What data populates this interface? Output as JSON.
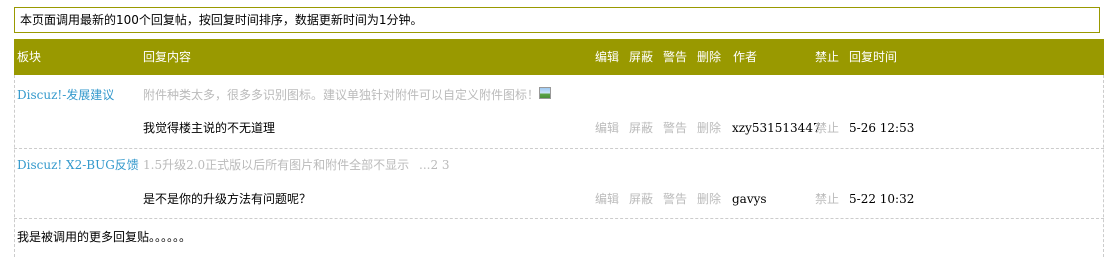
{
  "notice": "本页面调用最新的100个回复帖，按回复时间排序，数据更新时间为1分钟。",
  "columns": {
    "forum": "板块",
    "content": "回复内容",
    "edit": "编辑",
    "block": "屏蔽",
    "warn": "警告",
    "delete": "删除",
    "author": "作者",
    "ban": "禁止",
    "time": "回复时间"
  },
  "rows": [
    {
      "forum": "Discuz!-发展建议",
      "thread": "附件种类太多，很多多识别图标。建议单独针对附件可以自定义附件图标！",
      "thread_pages": "",
      "has_image_icon": true,
      "reply": "我觉得楼主说的不无道理",
      "edit": "编辑",
      "block": "屏蔽",
      "warn": "警告",
      "delete": "删除",
      "author": "xzy531513447",
      "ban": "禁止",
      "time": "5-26 12:53"
    },
    {
      "forum": "Discuz! X2-BUG反馈",
      "thread": "1.5升级2.0正式版以后所有图片和附件全部不显示",
      "thread_pages": "...2 3",
      "has_image_icon": false,
      "reply": "是不是你的升级方法有问题呢？",
      "edit": "编辑",
      "block": "屏蔽",
      "warn": "警告",
      "delete": "删除",
      "author": "gavys",
      "ban": "禁止",
      "time": "5-22 10:32"
    }
  ],
  "more": "我是被调用的更多回复贴。。。。。。",
  "colors": {
    "header_bg": "#999900",
    "forum_link": "#3399cc",
    "muted": "#bbbbbb"
  },
  "icons": {
    "attachment_image": "image-icon"
  }
}
